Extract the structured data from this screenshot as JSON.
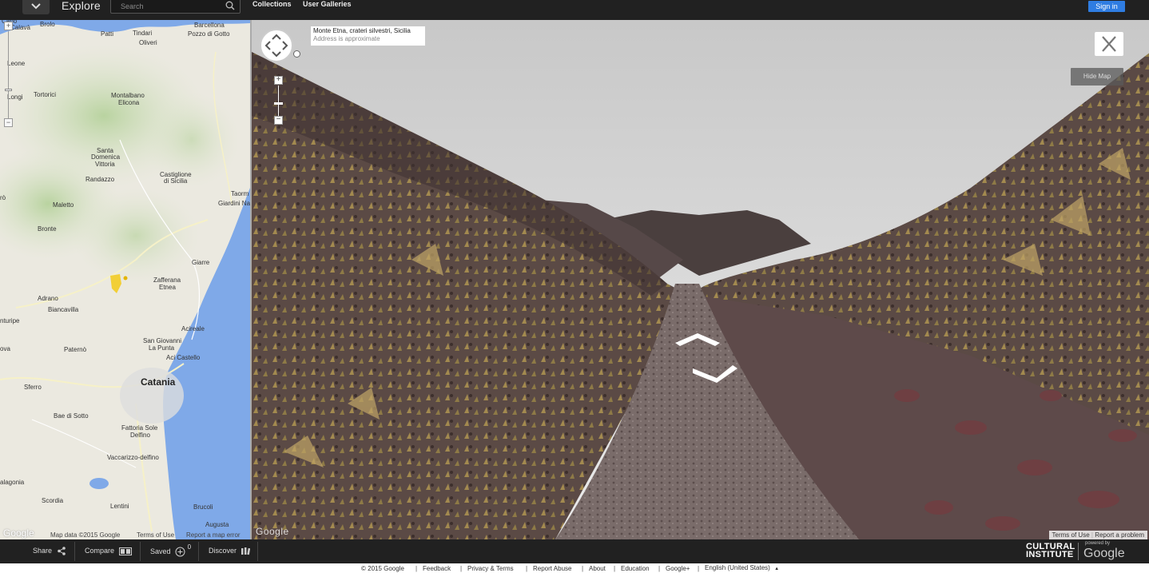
{
  "topbar": {
    "title": "Explore",
    "search_placeholder": "Search",
    "nav": [
      "Collections",
      "User Galleries"
    ],
    "signin": "Sign in",
    "accent": "#2f7de2"
  },
  "map": {
    "labels": [
      {
        "t": "Capo",
        "cls": ""
      },
      {
        "t": "Calavà",
        "cls": ""
      },
      {
        "t": "Brolo",
        "cls": ""
      },
      {
        "t": "Barcellona",
        "cls": ""
      },
      {
        "t": "Pozzo di Gotto",
        "cls": ""
      },
      {
        "t": "Patti",
        "cls": ""
      },
      {
        "t": "Tindari",
        "cls": ""
      },
      {
        "t": "Oliveri",
        "cls": ""
      },
      {
        "t": "Leone",
        "cls": ""
      },
      {
        "t": "Longi",
        "cls": ""
      },
      {
        "t": "Tortorici",
        "cls": ""
      },
      {
        "t": "Montalbano",
        "cls": ""
      },
      {
        "t": "Elicona",
        "cls": ""
      },
      {
        "t": "Santa",
        "cls": ""
      },
      {
        "t": "Domenica",
        "cls": ""
      },
      {
        "t": "Vittoria",
        "cls": ""
      },
      {
        "t": "Castiglione",
        "cls": ""
      },
      {
        "t": "di Sicilia",
        "cls": ""
      },
      {
        "t": "Randazzo",
        "cls": ""
      },
      {
        "t": "Taorm",
        "cls": ""
      },
      {
        "t": "Giardini Na",
        "cls": ""
      },
      {
        "t": "rò",
        "cls": ""
      },
      {
        "t": "Maletto",
        "cls": ""
      },
      {
        "t": "Bronte",
        "cls": ""
      },
      {
        "t": "Giarre",
        "cls": ""
      },
      {
        "t": "Zafferana",
        "cls": ""
      },
      {
        "t": "Etnea",
        "cls": ""
      },
      {
        "t": "Adrano",
        "cls": ""
      },
      {
        "t": "Biancavilla",
        "cls": ""
      },
      {
        "t": "nturipe",
        "cls": ""
      },
      {
        "t": "Acireale",
        "cls": ""
      },
      {
        "t": "San Giovanni",
        "cls": ""
      },
      {
        "t": "La Punta",
        "cls": ""
      },
      {
        "t": "Aci Castello",
        "cls": ""
      },
      {
        "t": "ova",
        "cls": ""
      },
      {
        "t": "Paternò",
        "cls": ""
      },
      {
        "t": "Catania",
        "cls": "big"
      },
      {
        "t": "Sferro",
        "cls": ""
      },
      {
        "t": "Bae di Sotto",
        "cls": ""
      },
      {
        "t": "Fattoria Sole",
        "cls": ""
      },
      {
        "t": "Delfino",
        "cls": ""
      },
      {
        "t": "Vaccarizzo-delfino",
        "cls": ""
      },
      {
        "t": "alagonia",
        "cls": ""
      },
      {
        "t": "Scordia",
        "cls": ""
      },
      {
        "t": "Lentini",
        "cls": ""
      },
      {
        "t": "Brucoli",
        "cls": ""
      },
      {
        "t": "Augusta",
        "cls": ""
      }
    ],
    "footer": {
      "data": "Map data ©2015 Google",
      "terms": "Terms of Use",
      "report": "Report a map error",
      "google": "Google"
    }
  },
  "streetview": {
    "address_line1": "Monte Etna, crateri silvestri, Sicilia",
    "address_line2": "Address is approximate",
    "hide_map": "Hide Map",
    "footer_terms": "Terms of Use",
    "footer_report": "Report a problem",
    "google": "Google"
  },
  "toolbar": {
    "share": "Share",
    "compare": "Compare",
    "saved": "Saved",
    "saved_count": "0",
    "discover": "Discover",
    "ci_line1": "CULTURAL",
    "ci_line2": "INSTITUTE",
    "powered_by": "powered by",
    "google": "Google"
  },
  "footer": {
    "links": [
      "© 2015 Google",
      "Feedback",
      "Privacy & Terms",
      "Report Abuse",
      "About",
      "Education",
      "Google+",
      "English (United States)"
    ]
  }
}
